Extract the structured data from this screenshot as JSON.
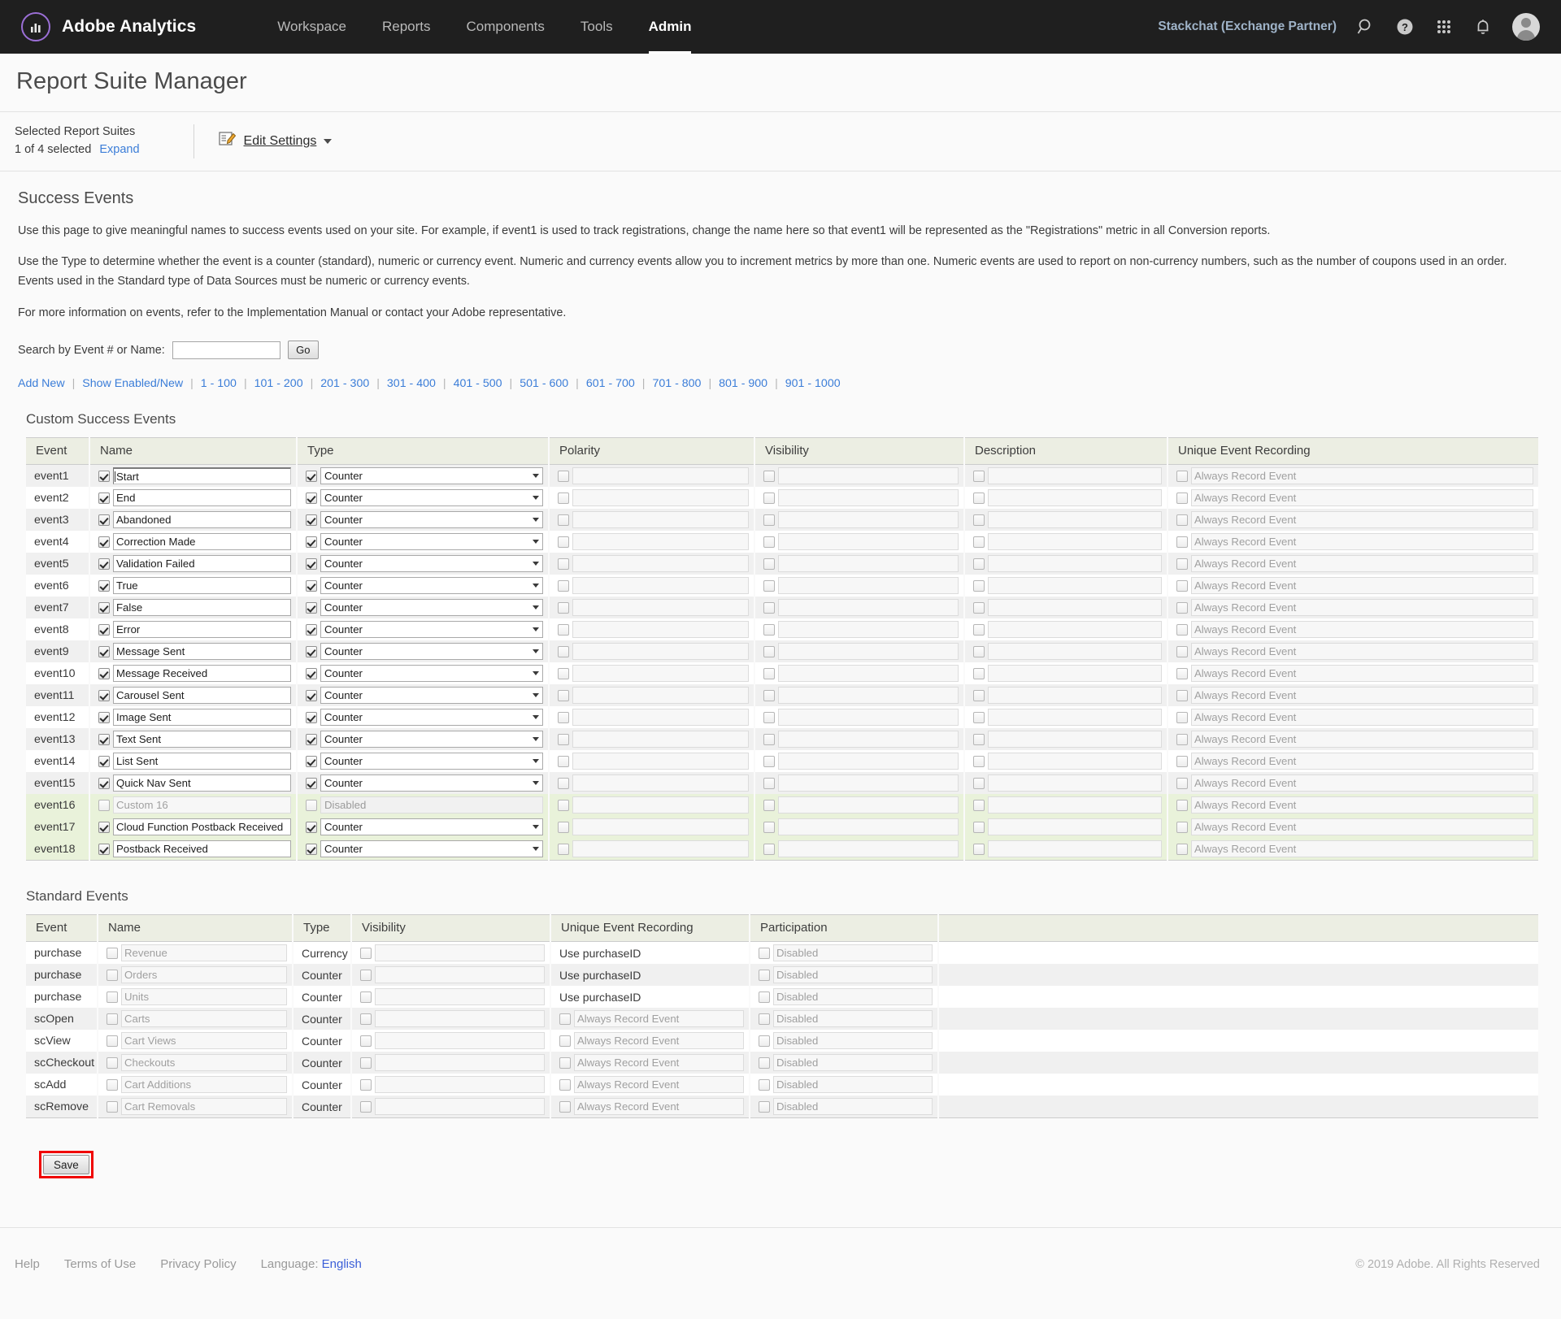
{
  "header": {
    "brand": "Adobe Analytics",
    "brand_logo_icon": "adobe-analytics-logo-icon",
    "nav": [
      {
        "label": "Workspace",
        "active": false
      },
      {
        "label": "Reports",
        "active": false
      },
      {
        "label": "Components",
        "active": false
      },
      {
        "label": "Tools",
        "active": false
      },
      {
        "label": "Admin",
        "active": true
      }
    ],
    "user": "Stackchat (Exchange Partner)",
    "icons": [
      "search-icon",
      "help-icon",
      "app-grid-icon",
      "bell-icon",
      "avatar"
    ]
  },
  "page": {
    "title": "Report Suite Manager"
  },
  "suite_bar": {
    "label": "Selected Report Suites",
    "selected_count": "1 of 4 selected",
    "expand": "Expand",
    "edit_settings": "Edit Settings",
    "edit_icon": "edit-pencil-icon"
  },
  "main": {
    "section_title": "Success Events",
    "paragraphs": [
      "Use this page to give meaningful names to success events used on your site. For example, if event1 is used to track registrations, change the name here so that event1 will be represented as the \"Registrations\" metric in all Conversion reports.",
      "Use the Type to determine whether the event is a counter (standard), numeric or currency event. Numeric and currency events allow you to increment metrics by more than one. Numeric events are used to report on non-currency numbers, such as the number of coupons used in an order.",
      "Events used in the Standard type of Data Sources must be numeric or currency events.",
      "For more information on events, refer to the Implementation Manual or contact your Adobe representative."
    ],
    "search": {
      "label": "Search by Event # or Name:",
      "value": "",
      "placeholder": "",
      "go_label": "Go"
    },
    "quick_links": [
      "Add New",
      "Show Enabled/New",
      "1 - 100",
      "101 - 200",
      "201 - 300",
      "301 - 400",
      "401 - 500",
      "501 - 600",
      "601 - 700",
      "701 - 800",
      "801 - 900",
      "901 - 1000"
    ]
  },
  "custom_events": {
    "title": "Custom Success Events",
    "columns": [
      "Event",
      "Name",
      "Type",
      "Polarity",
      "Visibility",
      "Description",
      "Unique Event Recording"
    ],
    "unique_placeholder": "Always Record Event",
    "rows": [
      {
        "event": "event1",
        "name": "Start",
        "name_checked": true,
        "name_focused": true,
        "type": "Counter",
        "type_checked": true,
        "type_disabled": false,
        "shade": "odd"
      },
      {
        "event": "event2",
        "name": "End",
        "name_checked": true,
        "name_focused": false,
        "type": "Counter",
        "type_checked": true,
        "type_disabled": false,
        "shade": "even"
      },
      {
        "event": "event3",
        "name": "Abandoned",
        "name_checked": true,
        "name_focused": false,
        "type": "Counter",
        "type_checked": true,
        "type_disabled": false,
        "shade": "odd"
      },
      {
        "event": "event4",
        "name": "Correction Made",
        "name_checked": true,
        "name_focused": false,
        "type": "Counter",
        "type_checked": true,
        "type_disabled": false,
        "shade": "even"
      },
      {
        "event": "event5",
        "name": "Validation Failed",
        "name_checked": true,
        "name_focused": false,
        "type": "Counter",
        "type_checked": true,
        "type_disabled": false,
        "shade": "odd"
      },
      {
        "event": "event6",
        "name": "True",
        "name_checked": true,
        "name_focused": false,
        "type": "Counter",
        "type_checked": true,
        "type_disabled": false,
        "shade": "even"
      },
      {
        "event": "event7",
        "name": "False",
        "name_checked": true,
        "name_focused": false,
        "type": "Counter",
        "type_checked": true,
        "type_disabled": false,
        "shade": "odd"
      },
      {
        "event": "event8",
        "name": "Error",
        "name_checked": true,
        "name_focused": false,
        "type": "Counter",
        "type_checked": true,
        "type_disabled": false,
        "shade": "even"
      },
      {
        "event": "event9",
        "name": "Message Sent",
        "name_checked": true,
        "name_focused": false,
        "type": "Counter",
        "type_checked": true,
        "type_disabled": false,
        "shade": "odd"
      },
      {
        "event": "event10",
        "name": "Message Received",
        "name_checked": true,
        "name_focused": false,
        "type": "Counter",
        "type_checked": true,
        "type_disabled": false,
        "shade": "even"
      },
      {
        "event": "event11",
        "name": "Carousel Sent",
        "name_checked": true,
        "name_focused": false,
        "type": "Counter",
        "type_checked": true,
        "type_disabled": false,
        "shade": "odd"
      },
      {
        "event": "event12",
        "name": "Image Sent",
        "name_checked": true,
        "name_focused": false,
        "type": "Counter",
        "type_checked": true,
        "type_disabled": false,
        "shade": "even"
      },
      {
        "event": "event13",
        "name": "Text Sent",
        "name_checked": true,
        "name_focused": false,
        "type": "Counter",
        "type_checked": true,
        "type_disabled": false,
        "shade": "odd"
      },
      {
        "event": "event14",
        "name": "List Sent",
        "name_checked": true,
        "name_focused": false,
        "type": "Counter",
        "type_checked": true,
        "type_disabled": false,
        "shade": "even"
      },
      {
        "event": "event15",
        "name": "Quick Nav Sent",
        "name_checked": true,
        "name_focused": false,
        "type": "Counter",
        "type_checked": true,
        "type_disabled": false,
        "shade": "odd"
      },
      {
        "event": "event16",
        "name": "Custom 16",
        "name_checked": false,
        "name_focused": false,
        "type": "Disabled",
        "type_checked": false,
        "type_disabled": true,
        "shade": "green"
      },
      {
        "event": "event17",
        "name": "Cloud Function Postback Received",
        "name_checked": true,
        "name_focused": false,
        "type": "Counter",
        "type_checked": true,
        "type_disabled": false,
        "shade": "green"
      },
      {
        "event": "event18",
        "name": "Postback  Received",
        "name_checked": true,
        "name_focused": false,
        "type": "Counter",
        "type_checked": true,
        "type_disabled": false,
        "shade": "green"
      }
    ]
  },
  "standard_events": {
    "title": "Standard Events",
    "columns": [
      "Event",
      "Name",
      "Type",
      "Visibility",
      "Unique Event Recording",
      "Participation"
    ],
    "participation_placeholder": "Disabled",
    "unique_placeholder": "Always Record Event",
    "rows": [
      {
        "event": "purchase",
        "name": "Revenue",
        "type": "Currency",
        "unique_text": "Use purchaseID",
        "unique_is_input": false,
        "shade": "even"
      },
      {
        "event": "purchase",
        "name": "Orders",
        "type": "Counter",
        "unique_text": "Use purchaseID",
        "unique_is_input": false,
        "shade": "odd"
      },
      {
        "event": "purchase",
        "name": "Units",
        "type": "Counter",
        "unique_text": "Use purchaseID",
        "unique_is_input": false,
        "shade": "even"
      },
      {
        "event": "scOpen",
        "name": "Carts",
        "type": "Counter",
        "unique_text": "Always Record Event",
        "unique_is_input": true,
        "shade": "odd"
      },
      {
        "event": "scView",
        "name": "Cart Views",
        "type": "Counter",
        "unique_text": "Always Record Event",
        "unique_is_input": true,
        "shade": "even"
      },
      {
        "event": "scCheckout",
        "name": "Checkouts",
        "type": "Counter",
        "unique_text": "Always Record Event",
        "unique_is_input": true,
        "shade": "odd"
      },
      {
        "event": "scAdd",
        "name": "Cart Additions",
        "type": "Counter",
        "unique_text": "Always Record Event",
        "unique_is_input": true,
        "shade": "even"
      },
      {
        "event": "scRemove",
        "name": "Cart Removals",
        "type": "Counter",
        "unique_text": "Always Record Event",
        "unique_is_input": true,
        "shade": "odd"
      }
    ]
  },
  "actions": {
    "save_label": "Save",
    "save_highlight_color": "#f00300"
  },
  "footer": {
    "links": [
      "Help",
      "Terms of Use",
      "Privacy Policy"
    ],
    "language_label": "Language:",
    "language_value": "English",
    "copyright": "© 2019 Adobe. All Rights Reserved"
  }
}
